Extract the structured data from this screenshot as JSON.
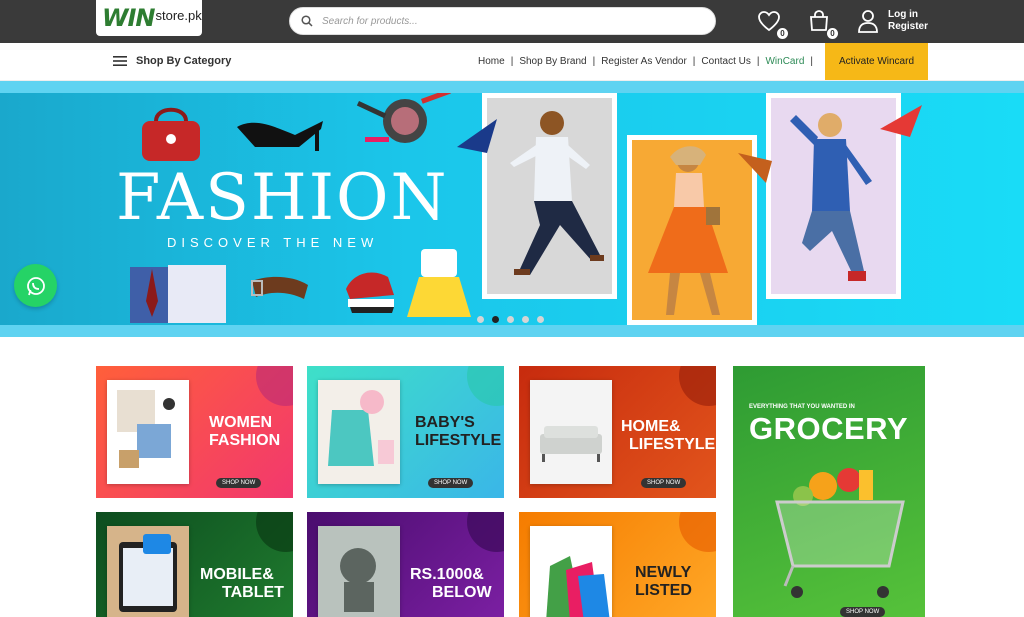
{
  "header": {
    "logo_win": "WIN",
    "logo_store": "store.pk",
    "search_placeholder": "Search for products...",
    "wishlist_count": "0",
    "cart_count": "0",
    "login_label": "Log in",
    "register_label": "Register"
  },
  "nav": {
    "category_label": "Shop By Category",
    "links": [
      "Home",
      "Shop By Brand",
      "Register As Vendor",
      "Contact Us",
      "WinCard"
    ],
    "activate_label": "Activate Wincard"
  },
  "hero": {
    "title": "FASHION",
    "subtitle": "DISCOVER THE NEW",
    "dots": 5,
    "active_dot": 1
  },
  "tiles": [
    {
      "line1": "WOMEN",
      "line2": "FASHION",
      "cta": "SHOP NOW"
    },
    {
      "line1": "BABY'S",
      "line2": "LIFESTYLE",
      "cta": "SHOP NOW"
    },
    {
      "line1": "HOME&",
      "line2": "LIFESTYLE",
      "cta": "SHOP NOW"
    },
    {
      "line1": "MOBILE&",
      "line2": "TABLET"
    },
    {
      "line1": "RS.1000&",
      "line2": "BELOW"
    },
    {
      "line1": "NEWLY",
      "line2": "LISTED"
    }
  ],
  "grocery": {
    "tagline": "EVERYTHING THAT YOU WANTED IN",
    "title": "GROCERY",
    "cta": "SHOP NOW"
  },
  "colors": {
    "topbar": "#3a3a3a",
    "accent_yellow": "#f6b817",
    "hero_cyan": "#1bc6ea",
    "whatsapp": "#25d366"
  }
}
